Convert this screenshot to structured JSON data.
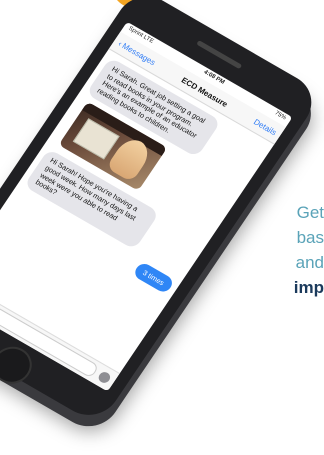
{
  "side_text": {
    "line1": "Get",
    "line2": "bas",
    "line3": "and",
    "line4": "imp"
  },
  "phone": {
    "status": {
      "carrier": "Sprint  LTE",
      "time": "4:08 PM",
      "battery": "75%"
    },
    "nav": {
      "back_label": "Messages",
      "title": "ECD Measure",
      "details_label": "Details"
    },
    "messages": [
      "Hi Sarah. Great job setting a goal to read books in your program. Here's an example of an educator reading books to children.",
      "Hi Sarah! Hope you're having a good week. How many days last week were you able to read books?"
    ],
    "reply": "3 times"
  },
  "colors": {
    "accent_orange": "#f5a623",
    "ios_blue": "#2f86f6",
    "teal_text": "#5aa3b8",
    "navy_text": "#1b3a5c"
  }
}
